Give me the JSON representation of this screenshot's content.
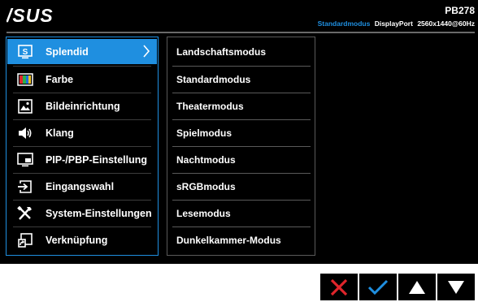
{
  "header": {
    "logo_text": "/SUS",
    "model": "PB278",
    "status": {
      "mode": "Standardmodus",
      "input": "DisplayPort",
      "resolution": "2560x1440@60Hz"
    }
  },
  "main_menu": {
    "items": [
      {
        "label": "Splendid",
        "icon": "splendid-icon",
        "active": true
      },
      {
        "label": "Farbe",
        "icon": "color-icon"
      },
      {
        "label": "Bildeinrichtung",
        "icon": "image-icon"
      },
      {
        "label": "Klang",
        "icon": "speaker-icon"
      },
      {
        "label": "PIP-/PBP-Einstellung",
        "icon": "pip-icon"
      },
      {
        "label": "Eingangswahl",
        "icon": "input-icon"
      },
      {
        "label": "System-Einstellungen",
        "icon": "wrench-icon"
      },
      {
        "label": "Verknüpfung",
        "icon": "shortcut-icon"
      }
    ]
  },
  "submenu": {
    "items": [
      {
        "label": "Landschaftsmodus"
      },
      {
        "label": "Standardmodus"
      },
      {
        "label": "Theatermodus"
      },
      {
        "label": "Spielmodus"
      },
      {
        "label": "Nachtmodus"
      },
      {
        "label": "sRGBmodus"
      },
      {
        "label": "Lesemodus"
      },
      {
        "label": "Dunkelkammer-Modus"
      }
    ]
  },
  "keys": [
    {
      "icon": "close-icon",
      "color": "#e0252b"
    },
    {
      "icon": "check-icon",
      "color": "#1f8fe0"
    },
    {
      "icon": "up-arrow-icon",
      "color": "#ffffff"
    },
    {
      "icon": "down-arrow-icon",
      "color": "#ffffff"
    }
  ],
  "colors": {
    "accent": "#1f8fe0",
    "background": "#000000",
    "cancel": "#e0252b"
  }
}
